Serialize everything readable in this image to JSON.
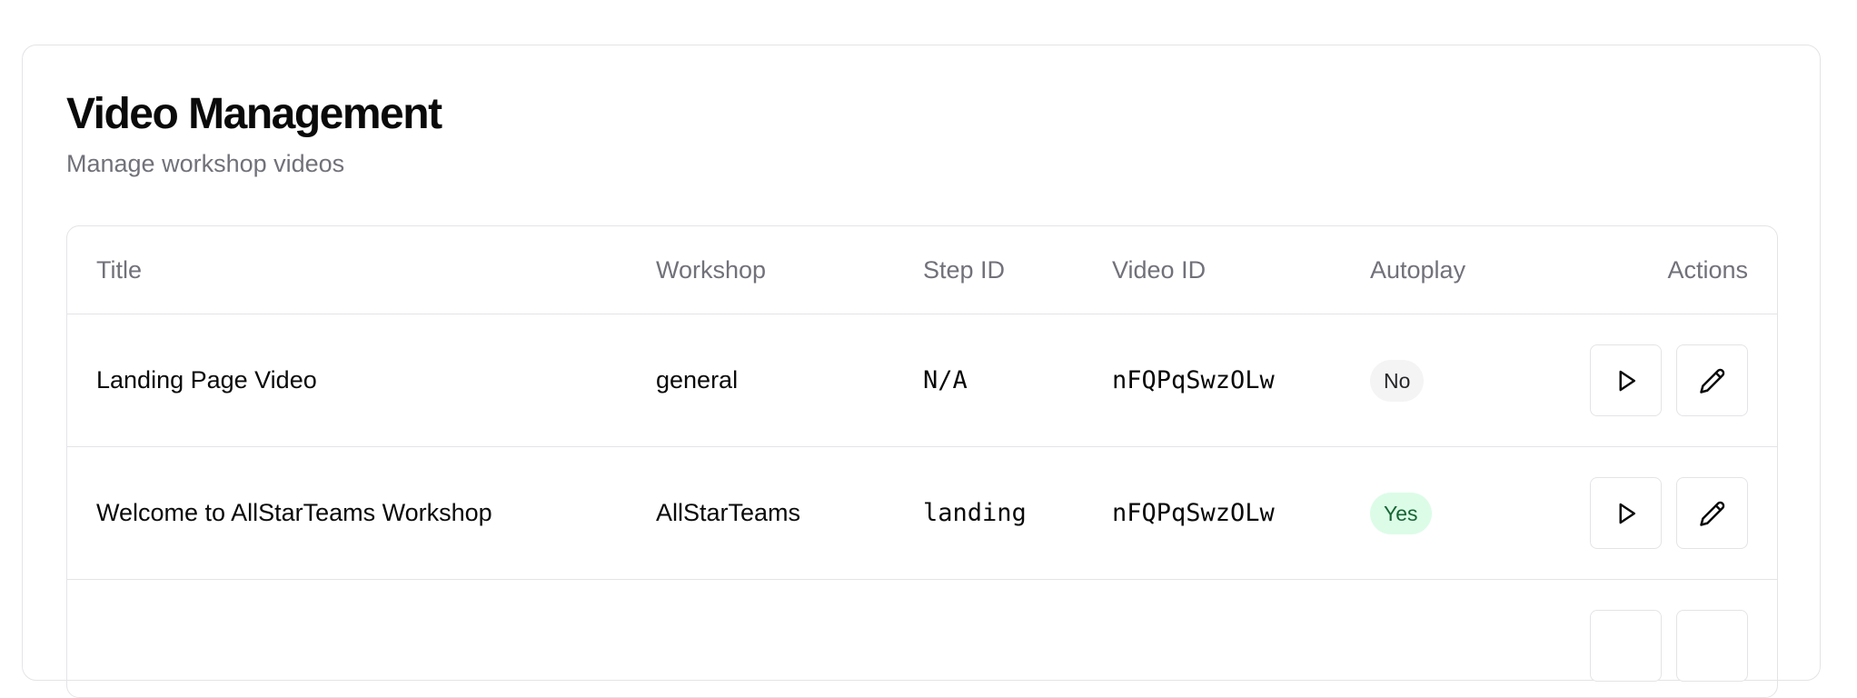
{
  "header": {
    "title": "Video Management",
    "subtitle": "Manage workshop videos"
  },
  "table": {
    "columns": {
      "title": "Title",
      "workshop": "Workshop",
      "step_id": "Step ID",
      "video_id": "Video ID",
      "autoplay": "Autoplay",
      "actions": "Actions"
    },
    "rows": [
      {
        "title": "Landing Page Video",
        "workshop": "general",
        "step_id": "N/A",
        "video_id": "nFQPqSwzOLw",
        "autoplay": "No",
        "autoplay_value": false,
        "actions": [
          "play-icon",
          "pencil-icon"
        ]
      },
      {
        "title": "Welcome to AllStarTeams Workshop",
        "workshop": "AllStarTeams",
        "step_id": "landing",
        "video_id": "nFQPqSwzOLw",
        "autoplay": "Yes",
        "autoplay_value": true,
        "actions": [
          "play-icon",
          "pencil-icon"
        ]
      }
    ]
  },
  "colors": {
    "badge_no_bg": "#f4f4f5",
    "badge_yes_bg": "#dcfce7",
    "badge_yes_text": "#166534",
    "muted_text": "#71717a",
    "border": "#e4e4e7"
  }
}
